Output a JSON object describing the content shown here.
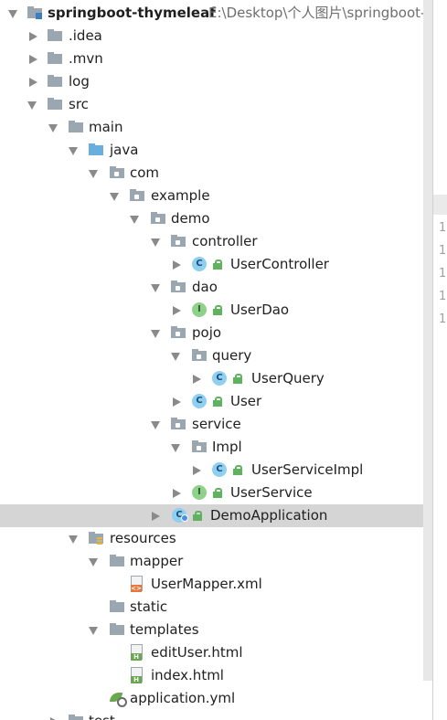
{
  "project": {
    "name": "springboot-thymeleaf",
    "path": "E:\\Desktop\\个人图片\\springboot-th"
  },
  "tree": [
    {
      "label": "springboot-thymeleaf",
      "icon": "module-icon",
      "expanded": true
    },
    {
      "label": ".idea",
      "icon": "folder-icon"
    },
    {
      "label": ".mvn",
      "icon": "folder-icon"
    },
    {
      "label": "log",
      "icon": "folder-icon"
    },
    {
      "label": "src",
      "icon": "folder-icon"
    },
    {
      "label": "main",
      "icon": "folder-icon"
    },
    {
      "label": "java",
      "icon": "source-folder-icon"
    },
    {
      "label": "com",
      "icon": "package-icon"
    },
    {
      "label": "example",
      "icon": "package-icon"
    },
    {
      "label": "demo",
      "icon": "package-icon"
    },
    {
      "label": "controller",
      "icon": "package-icon"
    },
    {
      "label": "UserController",
      "icon": "class-icon"
    },
    {
      "label": "dao",
      "icon": "package-icon"
    },
    {
      "label": "UserDao",
      "icon": "interface-icon"
    },
    {
      "label": "pojo",
      "icon": "package-icon"
    },
    {
      "label": "query",
      "icon": "package-icon"
    },
    {
      "label": "UserQuery",
      "icon": "class-icon"
    },
    {
      "label": "User",
      "icon": "class-icon"
    },
    {
      "label": "service",
      "icon": "package-icon"
    },
    {
      "label": "Impl",
      "icon": "package-icon"
    },
    {
      "label": "UserServiceImpl",
      "icon": "class-icon"
    },
    {
      "label": "UserService",
      "icon": "interface-icon"
    },
    {
      "label": "DemoApplication",
      "icon": "spring-boot-app-icon",
      "selected": true
    },
    {
      "label": "resources",
      "icon": "resources-folder-icon"
    },
    {
      "label": "mapper",
      "icon": "folder-icon"
    },
    {
      "label": "UserMapper.xml",
      "icon": "xml-file-icon"
    },
    {
      "label": "static",
      "icon": "folder-icon"
    },
    {
      "label": "templates",
      "icon": "folder-icon"
    },
    {
      "label": "editUser.html",
      "icon": "html-file-icon"
    },
    {
      "label": "index.html",
      "icon": "html-file-icon"
    },
    {
      "label": "application.yml",
      "icon": "yml-file-icon"
    },
    {
      "label": "test",
      "icon": "folder-icon"
    }
  ],
  "icons": {
    "class_letter": "C",
    "interface_letter": "I",
    "xml_badge": "<>",
    "html_badge": "H"
  },
  "gutter": {
    "line_numbers": [
      "1",
      "1",
      "1",
      "1",
      "1"
    ]
  },
  "colors": {
    "selection": "#d5d5d5",
    "folder": "#9aa7b0",
    "source_folder": "#6aaee0",
    "class": "#8fcff0",
    "interface": "#8fd08a"
  }
}
